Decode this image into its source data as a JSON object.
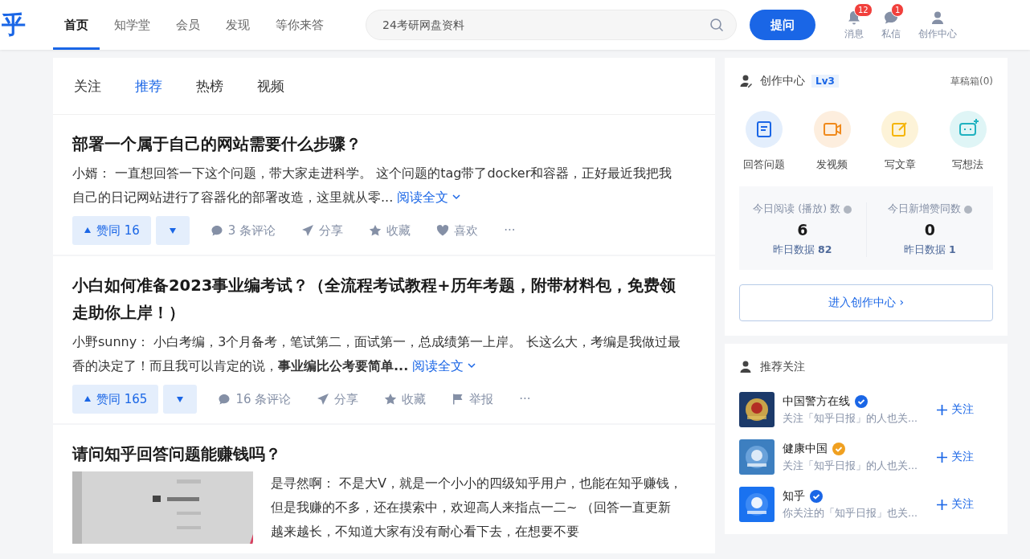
{
  "header": {
    "logo": "乎",
    "nav": [
      {
        "label": "首页",
        "selected": true
      },
      {
        "label": "知学堂",
        "selected": false
      },
      {
        "label": "会员",
        "selected": false
      },
      {
        "label": "发现",
        "selected": false
      },
      {
        "label": "等你来答",
        "selected": false
      }
    ],
    "search": {
      "placeholder": "24考研网盘资料"
    },
    "ask_button": "提问",
    "actions": [
      {
        "kind": "bell",
        "label": "消息",
        "badge": "12"
      },
      {
        "kind": "chat",
        "label": "私信",
        "badge": "1"
      },
      {
        "kind": "user",
        "label": "创作中心"
      }
    ]
  },
  "feed_tabs": [
    {
      "label": "关注",
      "selected": false
    },
    {
      "label": "推荐",
      "selected": true
    },
    {
      "label": "热榜",
      "selected": false
    },
    {
      "label": "视频",
      "selected": false
    }
  ],
  "feed": [
    {
      "title": "部署一个属于自己的网站需要什么步骤？",
      "excerpt": "小婿： 一直想回答一下这个问题，带大家走进科学。 这个问题的tag带了docker和容器，正好最近我把我自己的日记网站进行了容器化的部署改造，这里就从零...",
      "read_more": "阅读全文",
      "upvote": "赞同 16",
      "actions": [
        {
          "kind": "comment",
          "label": "3 条评论"
        },
        {
          "kind": "share",
          "label": "分享"
        },
        {
          "kind": "star",
          "label": "收藏"
        },
        {
          "kind": "heart",
          "label": "喜欢"
        },
        {
          "kind": "more",
          "label": "···"
        }
      ]
    },
    {
      "title": "小白如何准备2023事业编考试？（全流程考试教程+历年考题，附带材料包，免费领走助你上岸！）",
      "excerpt": "小野sunny： 小白考编，3个月备考，笔试第二，面试第一，总成绩第一上岸。 长这么大，考编是我做过最香的决定了！而且我可以肯定的说，**事业编比公考要简单...**",
      "read_more": "阅读全文",
      "upvote": "赞同 165",
      "actions": [
        {
          "kind": "comment",
          "label": "16 条评论"
        },
        {
          "kind": "share",
          "label": "分享"
        },
        {
          "kind": "star",
          "label": "收藏"
        },
        {
          "kind": "flag",
          "label": "举报"
        },
        {
          "kind": "more",
          "label": "···"
        }
      ]
    },
    {
      "title": "请问知乎回答问题能赚钱吗？",
      "excerpt": "是寻然啊： 不是大V，就是一个小小的四级知乎用户，也能在知乎赚钱，但是我赚的不多，还在摸索中，欢迎高人来指点一二~ （回答一直更新越来越长，不知道大家有没有耐心看下去，在想要不要"
    }
  ],
  "creator": {
    "title": "创作中心",
    "level": "Lv3",
    "drafts": "草稿箱(0)",
    "tools": [
      {
        "kind": "answer",
        "label": "回答问题"
      },
      {
        "kind": "video",
        "label": "发视频"
      },
      {
        "kind": "article",
        "label": "写文章"
      },
      {
        "kind": "idea",
        "label": "写想法"
      }
    ],
    "stats": [
      {
        "label": "今日阅读 (播放) 数",
        "value": "6",
        "yesterday": "昨日数据 **82**"
      },
      {
        "label": "今日新增赞同数",
        "value": "0",
        "yesterday": "昨日数据 **1**"
      }
    ],
    "enter_button": "进入创作中心 ›"
  },
  "recommend": {
    "title": "推荐关注",
    "users": [
      {
        "name": "中国警方在线",
        "color": "#1a66e6",
        "desc": "关注「知乎日报」的人也关...",
        "follow": "关注"
      },
      {
        "name": "健康中国",
        "color": "#f0a020",
        "desc": "关注「知乎日报」的人也关...",
        "follow": "关注"
      },
      {
        "name": "知乎",
        "color": "#1a66e6",
        "desc": "你关注的「知乎日报」也关...",
        "follow": "关注"
      }
    ]
  }
}
